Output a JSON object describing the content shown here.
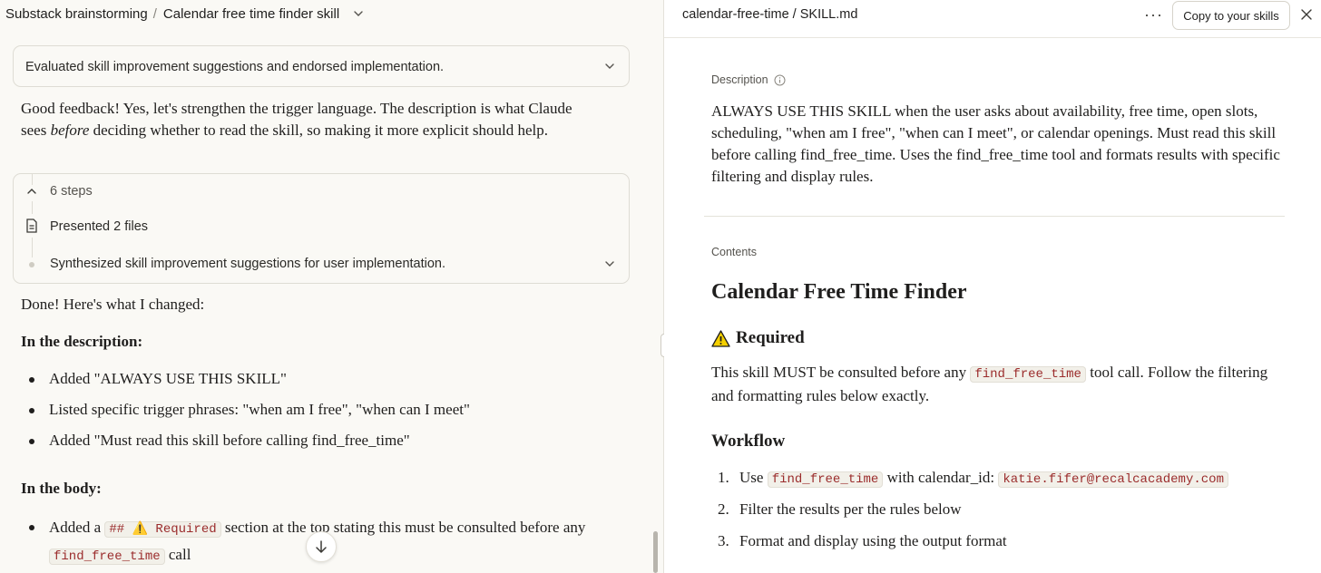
{
  "left": {
    "breadcrumb": {
      "project": "Substack brainstorming",
      "separator": "/",
      "chat": "Calendar free time finder skill"
    },
    "thinking_summary": "Evaluated skill improvement suggestions and endorsed implementation.",
    "reply1": {
      "before": "Good feedback! Yes, let's strengthen the trigger language. The description is what Claude sees ",
      "em": "before",
      "after": " deciding whether to read the skill, so making it more explicit should help."
    },
    "steps": {
      "count_label": "6 steps",
      "items": [
        {
          "icon": "file-icon",
          "label": "Presented 2 files"
        },
        {
          "icon": "dot",
          "label": "Synthesized skill improvement suggestions for user implementation."
        }
      ]
    },
    "done_text": "Done! Here's what I changed:",
    "section1": {
      "heading": "In the description:",
      "items": [
        "Added \"ALWAYS USE THIS SKILL\"",
        "Listed specific trigger phrases: \"when am I free\", \"when can I meet\"",
        "Added \"Must read this skill before calling find_free_time\""
      ]
    },
    "section2": {
      "heading": "In the body:",
      "item": {
        "pre": "Added a ",
        "code1": "## ⚠️ Required",
        "mid": " section at the top stating this must be consulted before any ",
        "code2": "find_free_time",
        "post": " call"
      }
    }
  },
  "right": {
    "file_path": "calendar-free-time / SKILL.md",
    "more_icon": "ellipsis-icon",
    "copy_button": "Copy to your skills",
    "close_icon": "close-icon",
    "description_label": "Description",
    "description": "ALWAYS USE THIS SKILL when the user asks about availability, free time, open slots, scheduling, \"when am I free\", \"when can I meet\", or calendar openings. Must read this skill before calling find_free_time. Uses the find_free_time tool and formats results with specific filtering and display rules.",
    "contents_label": "Contents",
    "title": "Calendar Free Time Finder",
    "required_heading": "Required",
    "required_para": {
      "pre": "This skill MUST be consulted before any ",
      "code": "find_free_time",
      "post": " tool call. Follow the filtering and formatting rules below exactly."
    },
    "workflow_heading": "Workflow",
    "workflow": [
      {
        "num": "1.",
        "pre": "Use ",
        "code1": "find_free_time",
        "mid": " with calendar_id: ",
        "code2": "katie.fifer@recalcacademy.com"
      },
      {
        "num": "2.",
        "text": "Filter the results per the rules below"
      },
      {
        "num": "3.",
        "text": "Format and display using the output format"
      }
    ]
  },
  "colors": {
    "code_text": "#9b2c2c",
    "code_bg": "#f2f0e9",
    "left_bg": "#faf9f5",
    "right_bg": "#ffffff"
  }
}
